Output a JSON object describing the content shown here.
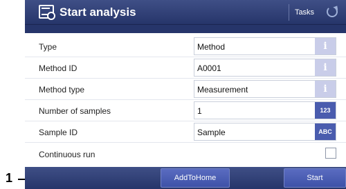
{
  "header": {
    "title": "Start analysis",
    "tasks_label": "Tasks"
  },
  "form": {
    "rows": [
      {
        "label": "Type",
        "value": "Method",
        "button": "i"
      },
      {
        "label": "Method ID",
        "value": "A0001",
        "button": "i"
      },
      {
        "label": "Method type",
        "value": "Measurement",
        "button": "i"
      },
      {
        "label": "Number of samples",
        "value": "1",
        "button": "123"
      },
      {
        "label": "Sample ID",
        "value": "Sample",
        "button": "ABC"
      }
    ],
    "continuous_label": "Continuous run",
    "continuous_checked": false
  },
  "footer": {
    "add_home_label": "AddToHome",
    "start_label": "Start"
  },
  "callout": {
    "number": "1"
  },
  "colors": {
    "header": "#26356a",
    "keypad_button": "#4a5cae",
    "info_button": "#c9cde9"
  },
  "icons": {
    "app": "start-analysis-icon",
    "refresh": "refresh-icon",
    "info": "info-icon"
  }
}
